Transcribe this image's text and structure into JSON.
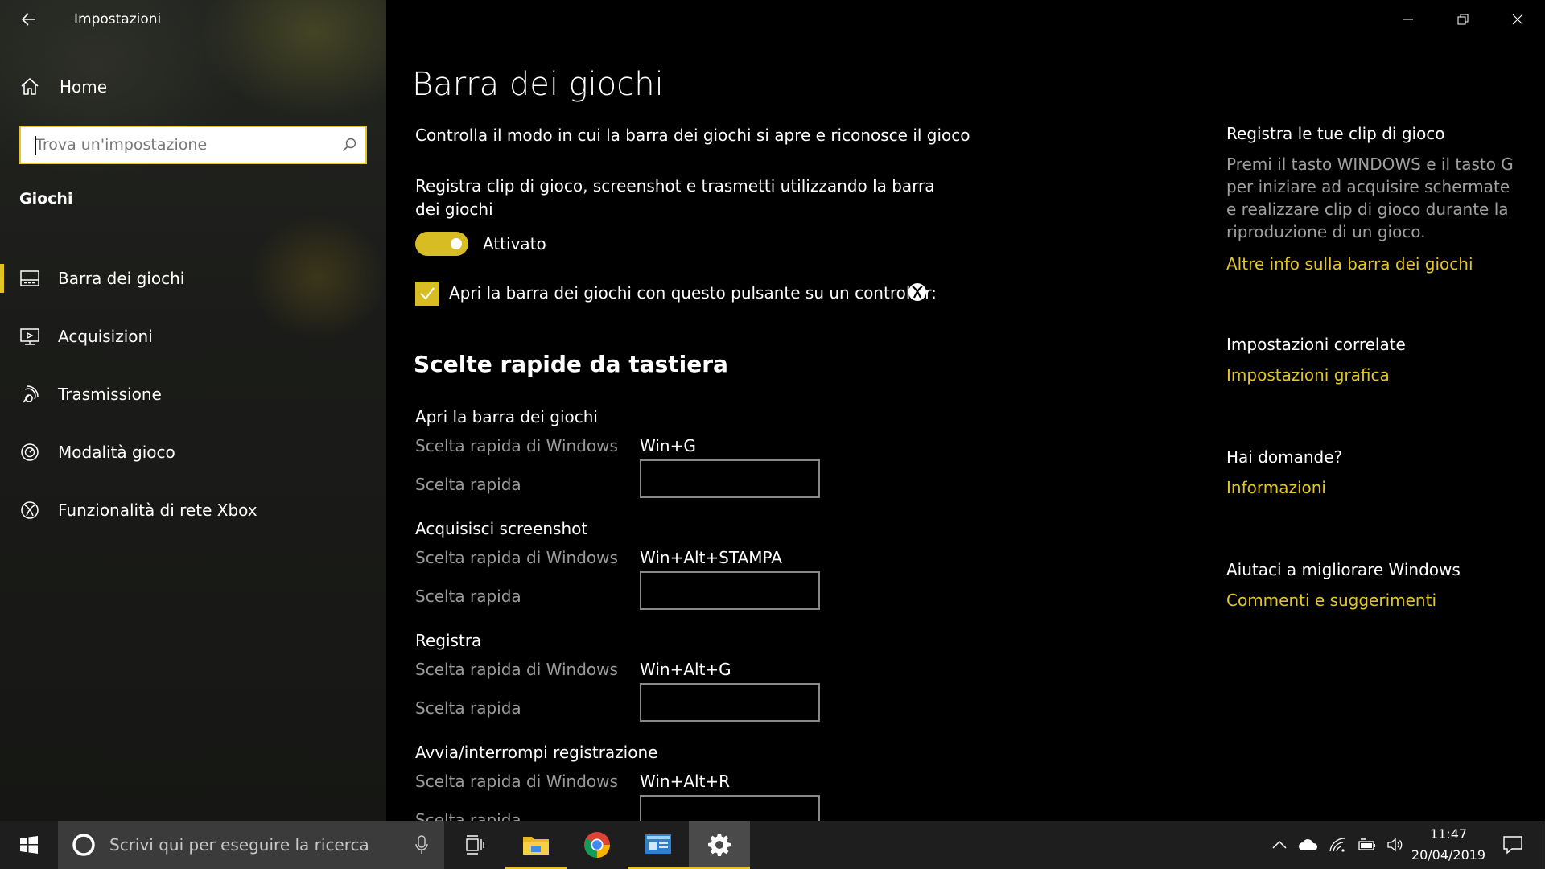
{
  "app": {
    "title": "Impostazioni"
  },
  "sidebar": {
    "home_label": "Home",
    "search_placeholder": "Trova un'impostazione",
    "section_title": "Giochi",
    "items": [
      {
        "label": "Barra dei giochi",
        "icon": "game-bar-icon",
        "active": true
      },
      {
        "label": "Acquisizioni",
        "icon": "captures-icon",
        "active": false
      },
      {
        "label": "Trasmissione",
        "icon": "broadcast-icon",
        "active": false
      },
      {
        "label": "Modalità gioco",
        "icon": "game-mode-icon",
        "active": false
      },
      {
        "label": "Funzionalità di rete Xbox",
        "icon": "xbox-icon",
        "active": false
      }
    ]
  },
  "main": {
    "title": "Barra dei giochi",
    "description": "Controlla il modo in cui la barra dei giochi si apre e riconosce il gioco",
    "record_option_text": "Registra clip di gioco, screenshot e trasmetti utilizzando la barra dei giochi",
    "toggle_state_label": "Attivato",
    "toggle_on": true,
    "controller_checkbox_label": "Apri la barra dei giochi con questo pulsante su un controller:",
    "controller_checked": true,
    "shortcuts_heading": "Scelte rapide da tastiera",
    "shortcuts": [
      {
        "name": "Apri la barra dei giochi",
        "windows_label": "Scelta rapida di Windows",
        "windows_value": "Win+G",
        "custom_label": "Scelta rapida",
        "custom_value": ""
      },
      {
        "name": "Acquisisci screenshot",
        "windows_label": "Scelta rapida di Windows",
        "windows_value": "Win+Alt+STAMPA",
        "custom_label": "Scelta rapida",
        "custom_value": ""
      },
      {
        "name": "Registra",
        "windows_label": "Scelta rapida di Windows",
        "windows_value": "Win+Alt+G",
        "custom_label": "Scelta rapida",
        "custom_value": ""
      },
      {
        "name": "Avvia/interrompi registrazione",
        "windows_label": "Scelta rapida di Windows",
        "windows_value": "Win+Alt+R",
        "custom_label": "Scelta rapida",
        "custom_value": ""
      }
    ]
  },
  "aside": {
    "clips_title": "Registra le tue clip di gioco",
    "clips_text": "Premi il tasto WINDOWS e il tasto G per iniziare ad acquisire schermate e realizzare clip di gioco durante la riproduzione di un gioco.",
    "clips_link": "Altre info sulla barra dei giochi",
    "related_title": "Impostazioni correlate",
    "related_link": "Impostazioni grafica",
    "questions_title": "Hai domande?",
    "questions_link": "Informazioni",
    "improve_title": "Aiutaci a migliorare Windows",
    "improve_link": "Commenti e suggerimenti"
  },
  "taskbar": {
    "search_placeholder": "Scrivi qui per eseguire la ricerca",
    "time": "11:47",
    "date": "20/04/2019"
  },
  "colors": {
    "accent": "#e3c626",
    "background": "#000000",
    "muted_text": "#9b9b9b"
  }
}
